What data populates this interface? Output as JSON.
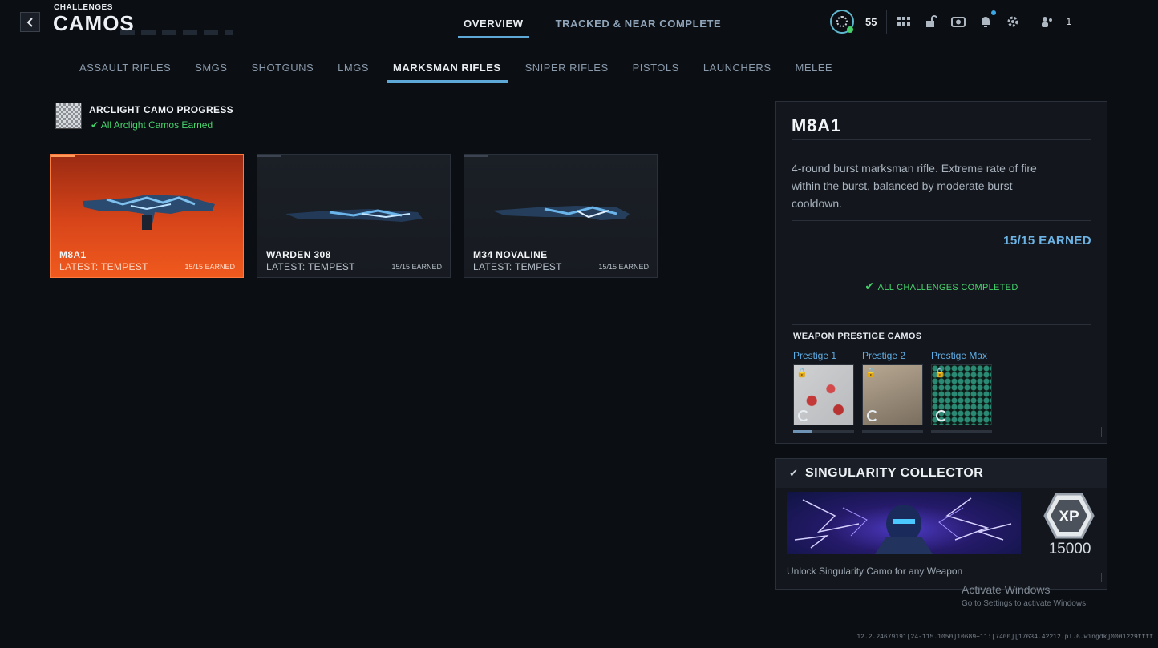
{
  "header": {
    "crumb": "CHALLENGES",
    "title": "CAMOS",
    "tabs": [
      {
        "label": "OVERVIEW",
        "active": true
      },
      {
        "label": "TRACKED & NEAR COMPLETE",
        "active": false
      }
    ],
    "rank_value": "55",
    "party_count": "1",
    "icons": [
      "apps-grid-icon",
      "unlock-icon",
      "camera-icon",
      "bell-icon",
      "gear-icon",
      "party-icon"
    ]
  },
  "categories": {
    "items": [
      "ASSAULT RIFLES",
      "SMGS",
      "SHOTGUNS",
      "LMGS",
      "MARKSMAN RIFLES",
      "SNIPER RIFLES",
      "PISTOLS",
      "LAUNCHERS",
      "MELEE"
    ],
    "active": "MARKSMAN RIFLES"
  },
  "progress": {
    "title": "ARCLIGHT CAMO PROGRESS",
    "status": "All Arclight Camos Earned"
  },
  "weapons": [
    {
      "name": "M8A1",
      "latest": "LATEST: TEMPEST",
      "earned": "15/15 EARNED",
      "active": true
    },
    {
      "name": "WARDEN 308",
      "latest": "LATEST: TEMPEST",
      "earned": "15/15 EARNED",
      "active": false
    },
    {
      "name": "M34 NOVALINE",
      "latest": "LATEST: TEMPEST",
      "earned": "15/15 EARNED",
      "active": false
    }
  ],
  "detail": {
    "name": "M8A1",
    "description": "4-round burst marksman rifle. Extreme rate of fire within the burst, balanced by moderate burst cooldown.",
    "earned": "15/15 EARNED",
    "all_challenges": "ALL CHALLENGES COMPLETED",
    "prestige_title": "WEAPON PRESTIGE CAMOS",
    "prestige": [
      {
        "label": "Prestige 1",
        "progress": 0.3
      },
      {
        "label": "Prestige 2",
        "progress": 0
      },
      {
        "label": "Prestige Max",
        "progress": 0
      }
    ]
  },
  "singularity": {
    "title": "SINGULARITY COLLECTOR",
    "xp_label": "XP",
    "xp_value": "15000",
    "description": "Unlock Singularity Camo for any Weapon"
  },
  "watermark": {
    "line1": "Activate Windows",
    "line2": "Go to Settings to activate Windows."
  },
  "build": "12.2.24679191[24-115.1050]10689+11:[7400][17634.42212.pl.6.wingdk]0001229ffff",
  "colors": {
    "accent": "#5ea8d8",
    "active_card": "#f05a1e",
    "success": "#47d36c",
    "link": "#5faee6"
  }
}
